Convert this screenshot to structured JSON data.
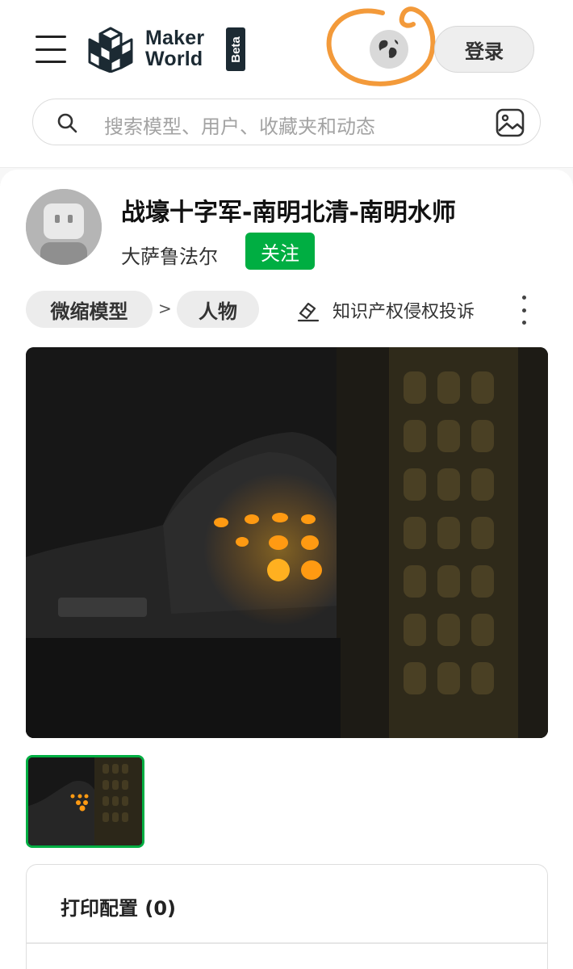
{
  "header": {
    "logo_line1": "Maker",
    "logo_line2": "World",
    "logo_badge": "Beta",
    "login_label": "登录",
    "search_placeholder": "搜索模型、用户、收藏夹和动态"
  },
  "model": {
    "title": "战壕十字军-南明北清-南明水师",
    "author": "大萨鲁法尔",
    "follow_label": "关注",
    "breadcrumb": [
      "微缩模型",
      "人物"
    ],
    "breadcrumb_separator": ">",
    "report_label": "知识产权侵权投诉"
  },
  "print_profiles": {
    "heading": "打印配置 (0)"
  },
  "colors": {
    "accent": "#00ae42",
    "annotation": "#f39a3a"
  },
  "icons": [
    "menu-icon",
    "logo-icon",
    "globe-icon",
    "search-icon",
    "image-search-icon",
    "report-icon",
    "more-icon"
  ]
}
